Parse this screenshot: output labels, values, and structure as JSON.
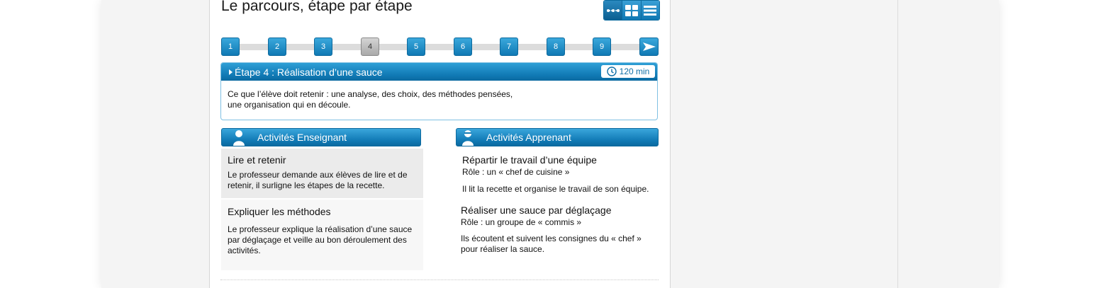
{
  "page": {
    "title": "Le parcours, étape par étape"
  },
  "view_switch": {
    "buttons": [
      {
        "icon": "timeline-icon"
      },
      {
        "icon": "grid-icon"
      },
      {
        "icon": "list-icon"
      }
    ]
  },
  "stepper": {
    "steps": [
      "1",
      "2",
      "3",
      "4",
      "5",
      "6",
      "7",
      "8",
      "9"
    ],
    "current": "4",
    "next_icon": "arrow-right-icon"
  },
  "step": {
    "title": "Étape 4 : Réalisation d’une sauce",
    "duration": "120 min",
    "description_line1": "Ce que l’élève doit retenir : une analyse, des choix, des méthodes pensées,",
    "description_line2": "une organisation qui en découle."
  },
  "teacher": {
    "header": "Activités Enseignant",
    "activities": [
      {
        "title": "Lire et retenir",
        "line1": "Le professeur demande aux élèves de lire et de",
        "line2": "retenir, il surligne les étapes de la recette."
      },
      {
        "title": "Expliquer les méthodes",
        "line1": "Le professeur explique la réalisation d’une sauce",
        "line2": "par déglaçage et veille au bon déroulement des",
        "line3": "activités."
      }
    ]
  },
  "learner": {
    "header": "Activités Apprenant",
    "activities": [
      {
        "title": "Répartir le travail d’une équipe",
        "role": "Rôle : un « chef de cuisine »",
        "line1": "Il lit la recette et organise le travail de son équipe."
      },
      {
        "title": "Réaliser une sauce par déglaçage",
        "role": "Rôle : un groupe de « commis »",
        "line1": "Ils écoutent et suivent les consignes du « chef »",
        "line2": "pour réaliser la sauce."
      }
    ]
  },
  "colors": {
    "accent": "#1079b4",
    "accent_light": "#3aa6dc",
    "current_step": "#b5b5b5"
  }
}
